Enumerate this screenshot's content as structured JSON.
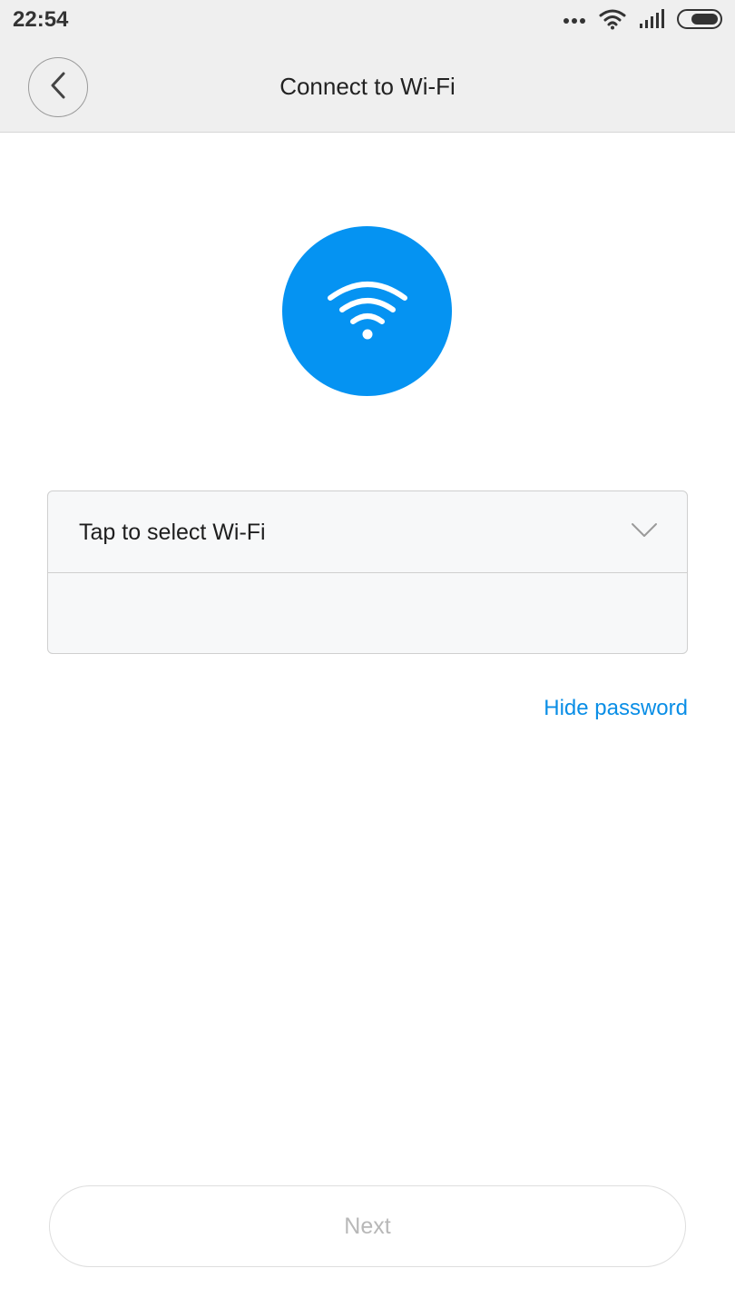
{
  "status_bar": {
    "time": "22:54",
    "icons": [
      "more-dots-icon",
      "wifi-signal-icon",
      "cell-signal-icon",
      "battery-icon"
    ]
  },
  "header": {
    "title": "Connect to Wi-Fi",
    "back_icon": "chevron-left-icon"
  },
  "hero": {
    "icon": "wifi-icon",
    "color": "#0593f2"
  },
  "form": {
    "wifi_select_label": "Tap to select Wi-Fi",
    "dropdown_icon": "chevron-down-icon",
    "password_value": "",
    "password_placeholder": ""
  },
  "hide_password_label": "Hide password",
  "next_label": "Next",
  "colors": {
    "accent": "#0593f2",
    "link": "#0a8ee6",
    "disabled_text": "#b8b8b8"
  }
}
